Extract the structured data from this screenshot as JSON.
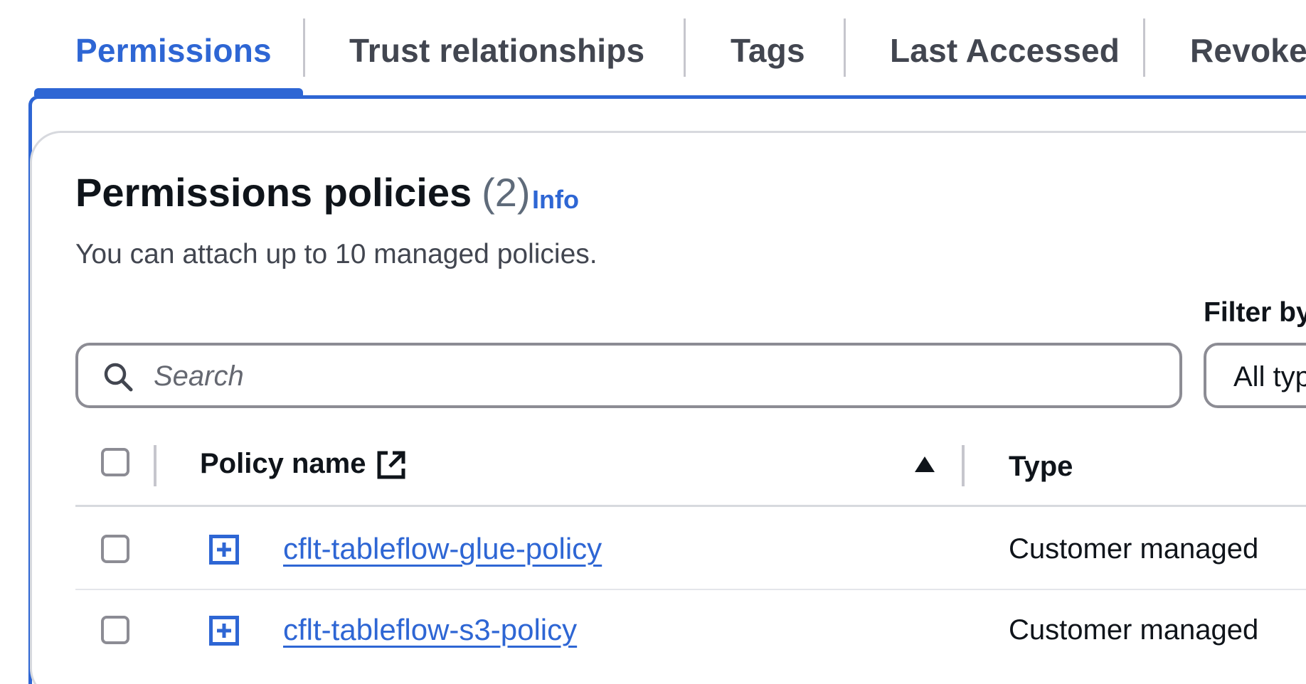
{
  "tabs": [
    {
      "label": "Permissions",
      "active": true
    },
    {
      "label": "Trust relationships",
      "active": false
    },
    {
      "label": "Tags",
      "active": false
    },
    {
      "label": "Last Accessed",
      "active": false
    },
    {
      "label": "Revoke",
      "active": false
    }
  ],
  "section": {
    "title": "Permissions policies",
    "count": "(2)",
    "info_label": "Info",
    "description": "You can attach up to 10 managed policies."
  },
  "filter": {
    "label": "Filter by",
    "selected_value": "All types"
  },
  "search": {
    "placeholder": "Search",
    "value": ""
  },
  "table": {
    "columns": {
      "policy_name": "Policy name",
      "type": "Type"
    },
    "sort": {
      "column": "policy_name",
      "direction": "ascending"
    },
    "rows": [
      {
        "policy_name": "cflt-tableflow-glue-policy",
        "type": "Customer managed"
      },
      {
        "policy_name": "cflt-tableflow-s3-policy",
        "type": "Customer managed"
      }
    ]
  },
  "icons": {
    "search": "search-icon",
    "external_link": "external-link-icon",
    "sort": "sort-ascending-icon",
    "expand": "expand-plus-icon"
  },
  "colors": {
    "accent": "#2e66d4",
    "text": "#0f141a",
    "muted": "#424650",
    "border": "#8c8c94"
  }
}
